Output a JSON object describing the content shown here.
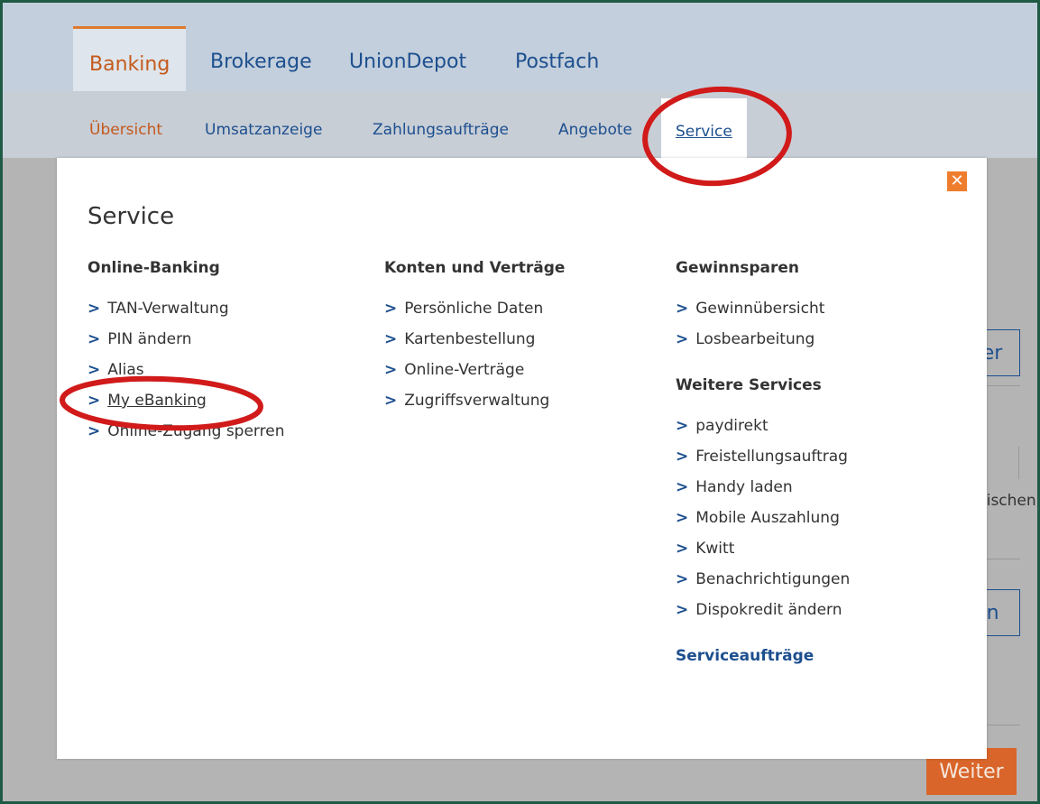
{
  "main_tabs": [
    {
      "label": "Banking"
    },
    {
      "label": "Brokerage"
    },
    {
      "label": "UnionDepot"
    },
    {
      "label": "Postfach"
    }
  ],
  "sub_tabs": [
    {
      "label": "Übersicht"
    },
    {
      "label": "Umsatzanzeige"
    },
    {
      "label": "Zahlungsaufträge"
    },
    {
      "label": "Angebote"
    },
    {
      "label": "Service"
    }
  ],
  "background": {
    "btn1": "Weiter",
    "text1": "lischen",
    "btn2": "ändern",
    "weiter": "Weiter"
  },
  "modal": {
    "title": "Service",
    "columns": [
      {
        "heading": "Online-Banking",
        "items": [
          "TAN-Verwaltung",
          "PIN ändern",
          "Alias",
          "My eBanking",
          "Online-Zugang sperren"
        ]
      },
      {
        "heading": "Konten und Verträge",
        "items": [
          "Persönliche Daten",
          "Kartenbestellung",
          "Online-Verträge",
          "Zugriffsverwaltung"
        ]
      },
      {
        "heading": "Gewinnsparen",
        "items": [
          "Gewinnübersicht",
          "Losbearbeitung"
        ],
        "heading2": "Weitere Services",
        "items2": [
          "paydirekt",
          "Freistellungsauftrag",
          "Handy laden",
          "Mobile Auszahlung",
          "Kwitt",
          "Benachrichtigungen",
          "Dispokredit ändern"
        ],
        "link": "Serviceaufträge"
      }
    ]
  },
  "colors": {
    "accent_orange": "#e07a2e",
    "link_blue": "#1d4f8f",
    "annotation_red": "#d11a1a"
  }
}
